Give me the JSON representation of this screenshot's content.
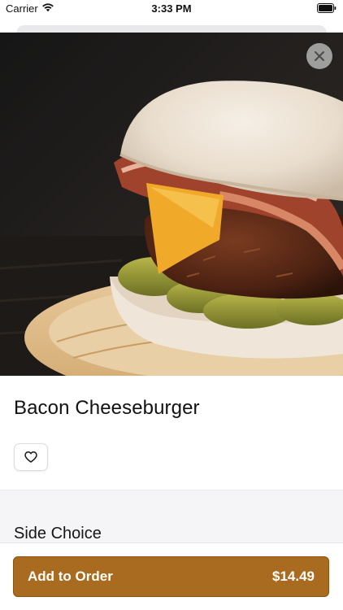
{
  "status_bar": {
    "carrier": "Carrier",
    "time": "3:33 PM",
    "icons": [
      "wifi-icon",
      "battery-icon"
    ]
  },
  "item": {
    "title": "Bacon Cheeseburger",
    "favorite_icon": "heart-icon"
  },
  "close_icon": "close-icon",
  "section": {
    "title": "Side Choice"
  },
  "order_button": {
    "label": "Add to Order",
    "price": "$14.49"
  },
  "colors": {
    "accent": "#a86b1f",
    "section_background": "#f5f5f7"
  }
}
